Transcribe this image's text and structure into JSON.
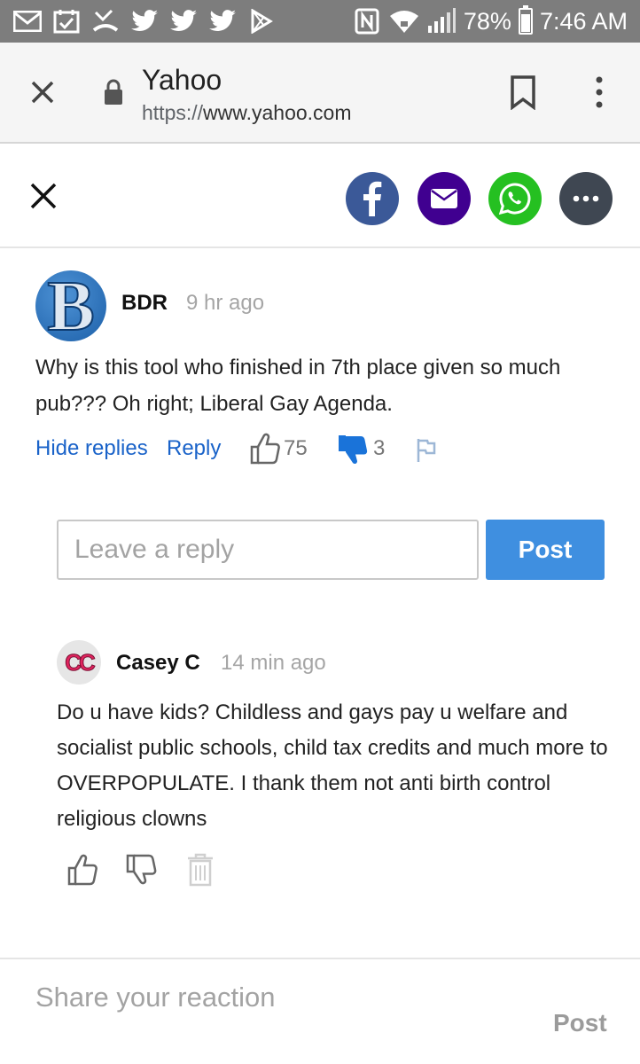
{
  "status_bar": {
    "left_icons": [
      "mail-icon",
      "calendar-check-icon",
      "missed-call-icon",
      "twitter-icon",
      "twitter-icon",
      "twitter-icon",
      "play-store-icon"
    ],
    "right_icons": [
      "nfc-icon",
      "wifi-icon",
      "signal-icon",
      "battery-icon"
    ],
    "battery_percent": "78%",
    "battery_level": 0.78,
    "time": "7:46 AM"
  },
  "browser": {
    "title": "Yahoo",
    "url_scheme": "https://",
    "url_host": "www.yahoo.com"
  },
  "share": {
    "buttons": [
      "facebook-icon",
      "email-icon",
      "whatsapp-icon",
      "more-icon"
    ],
    "colors": {
      "facebook": "#3b5998",
      "email": "#400090",
      "whatsapp": "#25c021",
      "more": "#3f4752"
    }
  },
  "comment": {
    "avatar_letter": "B",
    "user": "BDR",
    "time": "9 hr ago",
    "body": "Why is this tool who finished in 7th place given so much pub??? Oh right; Liberal Gay Agenda.",
    "hide_replies_label": "Hide replies",
    "reply_label": "Reply",
    "thumbs_up_count": "75",
    "thumbs_down_count": "3"
  },
  "reply_box": {
    "placeholder": "Leave a reply",
    "post_label": "Post"
  },
  "reply": {
    "avatar_text": "CC",
    "user": "Casey C",
    "time": "14 min ago",
    "body": "Do u have kids? Childless and gays pay u welfare and socialist public schools, child tax credits and much more to OVERPOPULATE. I thank them not anti birth control religious clowns"
  },
  "reaction": {
    "placeholder": "Share your reaction",
    "post_label": "Post"
  },
  "colors": {
    "link": "#1a63c9",
    "post_button": "#3f8fe0",
    "status_bar": "#7d7d7d"
  }
}
